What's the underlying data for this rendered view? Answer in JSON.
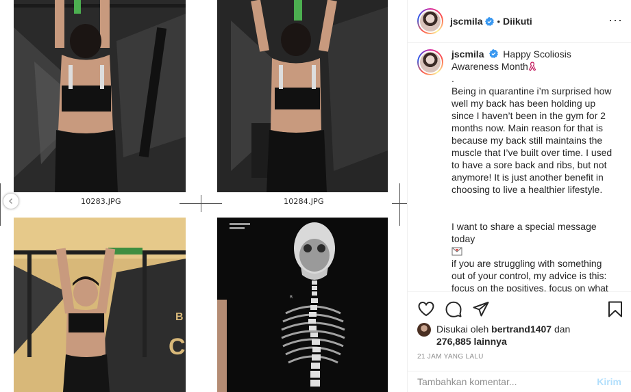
{
  "media": {
    "captions": [
      "10283.JPG",
      "10284.JPG"
    ]
  },
  "header": {
    "username": "jscmila",
    "separator": "•",
    "follow_state": "Diikuti",
    "more": "···"
  },
  "caption": {
    "username": "jscmila",
    "text_intro": "Happy Scoliosis Awareness Month",
    "dot": ".",
    "paragraph_1": "Being in quarantine i’m surprised how well my back has been holding up since I haven’t been in the gym for 2 months now. Main reason for that is because my back still maintains the muscle that I’ve built over time. I used to have a sore back and ribs, but not anymore! It is just another benefit in choosing to live a healthier lifestyle.",
    "paragraph_2a": "I want to share a special message today",
    "paragraph_2b": "if you are struggling with something out of your control, my advice is this: focus on the positives, focus on what u can do, keep trying, and never give up"
  },
  "likes": {
    "prefix": "Disukai oleh",
    "user": "bertrand1407",
    "joiner": "dan",
    "count": "276,885 lainnya"
  },
  "timestamp": "21 JAM YANG LALU",
  "comment": {
    "placeholder": "Tambahkan komentar...",
    "post_label": "Kirim"
  },
  "colors": {
    "verified": "#3897f0",
    "heart": "#d6121f",
    "post_disabled": "#b2dffc"
  }
}
